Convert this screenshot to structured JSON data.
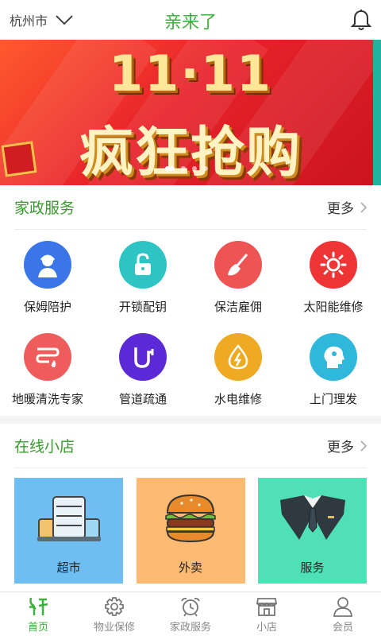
{
  "header": {
    "city": "杭州市",
    "title": "亲来了"
  },
  "banner": {
    "number": "11·11",
    "slogan": "疯狂抢购",
    "page_count": 4,
    "active_page": 1
  },
  "home_services": {
    "title": "家政服务",
    "more": "更多",
    "items": [
      {
        "label": "保姆陪护",
        "icon": "nanny-icon",
        "color": "#3a76e8"
      },
      {
        "label": "开锁配钥",
        "icon": "unlock-icon",
        "color": "#2fc4c4"
      },
      {
        "label": "保洁雇佣",
        "icon": "broom-icon",
        "color": "#ef5454"
      },
      {
        "label": "太阳能维修",
        "icon": "sun-icon",
        "color": "#ee3434"
      },
      {
        "label": "地暖清洗专家",
        "icon": "floor-heating-icon",
        "color": "#ef5c5c"
      },
      {
        "label": "管道疏通",
        "icon": "pipe-icon",
        "color": "#5b2ad6"
      },
      {
        "label": "水电维修",
        "icon": "water-electric-icon",
        "color": "#eeaa22"
      },
      {
        "label": "上门理发",
        "icon": "haircut-icon",
        "color": "#2fb8dc"
      }
    ]
  },
  "online_shop": {
    "title": "在线小店",
    "more": "更多",
    "items": [
      {
        "label": "超市",
        "icon": "supermarket-icon",
        "color": "#6fbef1"
      },
      {
        "label": "外卖",
        "icon": "burger-icon",
        "color": "#fdba72"
      },
      {
        "label": "服务",
        "icon": "suit-icon",
        "color": "#4fe0b5"
      }
    ]
  },
  "tabbar": {
    "items": [
      {
        "label": "首页",
        "icon": "home-icon"
      },
      {
        "label": "物业保修",
        "icon": "gear-icon"
      },
      {
        "label": "家政服务",
        "icon": "alarm-clock-icon"
      },
      {
        "label": "小店",
        "icon": "shop-icon"
      },
      {
        "label": "会员",
        "icon": "user-icon"
      }
    ],
    "active": 0,
    "active_color": "#3db13d"
  }
}
